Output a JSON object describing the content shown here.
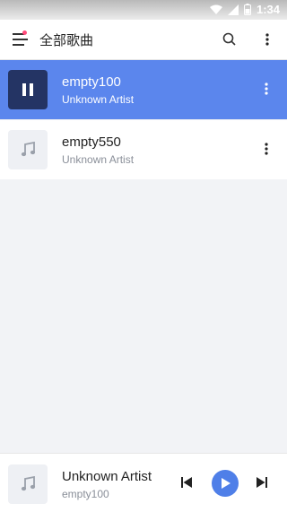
{
  "status": {
    "time": "1:34"
  },
  "appbar": {
    "title": "全部歌曲"
  },
  "songs": [
    {
      "title": "empty100",
      "artist": "Unknown Artist",
      "playing": true
    },
    {
      "title": "empty550",
      "artist": "Unknown Artist",
      "playing": false
    }
  ],
  "player": {
    "line1": "Unknown Artist",
    "line2": "empty100"
  },
  "colors": {
    "accent": "#5b86ed",
    "thumb_active": "#243464",
    "notification_dot": "#ff4a79"
  },
  "icons": [
    "menu-icon",
    "search-icon",
    "more-vert-icon",
    "pause-icon",
    "music-note-icon",
    "skip-previous-icon",
    "play-icon",
    "skip-next-icon"
  ]
}
